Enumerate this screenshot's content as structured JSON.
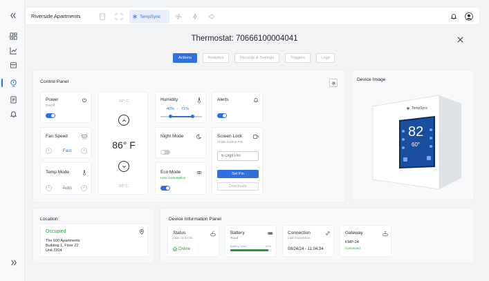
{
  "sidebar": {
    "items": [
      {
        "name": "collapse-sidebar-icon"
      },
      {
        "name": "dashboard-icon"
      },
      {
        "name": "analytics-icon"
      },
      {
        "name": "building-icon"
      },
      {
        "name": "thermostat-icon"
      },
      {
        "name": "reports-icon"
      },
      {
        "name": "notifications-icon"
      },
      {
        "name": "expand-sidebar-icon"
      }
    ],
    "accent": "#2f6fe0"
  },
  "topbar": {
    "title": "Riverside Apartments",
    "active_app": "TempSync"
  },
  "page": {
    "title": "Thermostat: 70666100004041"
  },
  "tabs": [
    "Actions",
    "Analytics",
    "Records & Settings",
    "Triggers",
    "Logs"
  ],
  "control_panel": {
    "title": "Control Panel",
    "power": {
      "label": "Power",
      "sub": "On/Off",
      "on": true
    },
    "fan_speed": {
      "label": "Fan Speed",
      "value": "Fast"
    },
    "temp_mode": {
      "label": "Temp Mode",
      "value": "Auto"
    },
    "thermostat": {
      "upper": "92° C",
      "temp": "86° F",
      "lower": "16° C"
    },
    "humidity": {
      "label": "Humidity",
      "min": "40%",
      "sep": "-",
      "max": "71%"
    },
    "night_mode": {
      "label": "Night Mode",
      "on": false
    },
    "eco_mode": {
      "label": "Eco Mode",
      "sub": "Less consumption",
      "on": true
    },
    "alerts": {
      "label": "Alerts",
      "on": true
    },
    "screen_lock": {
      "label": "Screen Lock",
      "sub": "Childs Control PIN",
      "pin_placeholder": "6-Digit Pin",
      "set_pin": "Set Pin",
      "deactivate": "Deactivate"
    }
  },
  "device_image": {
    "title": "Device Image",
    "brand": "TempSync",
    "display_temp": "82",
    "display_set": "60°"
  },
  "location": {
    "title": "Location",
    "status": "Occupied",
    "line1": "The 600 Apartments",
    "line2": "Building 1, Floor 22",
    "line3": "Unit 2204"
  },
  "device_info": {
    "title": "Device Information Panel",
    "status": {
      "label": "Status",
      "sub": "Last: 11:04:34",
      "value": "Online"
    },
    "battery": {
      "label": "Battery",
      "sub": "Good",
      "level_label": "Battery Level",
      "percent": "92%",
      "level": 0.92
    },
    "connection": {
      "label": "Connection",
      "sub": "Last Connection",
      "value": "08/24/24 - 11:04:34"
    },
    "gateway": {
      "label": "Gateway",
      "value": "KMP-24",
      "sub": "Connected"
    }
  }
}
